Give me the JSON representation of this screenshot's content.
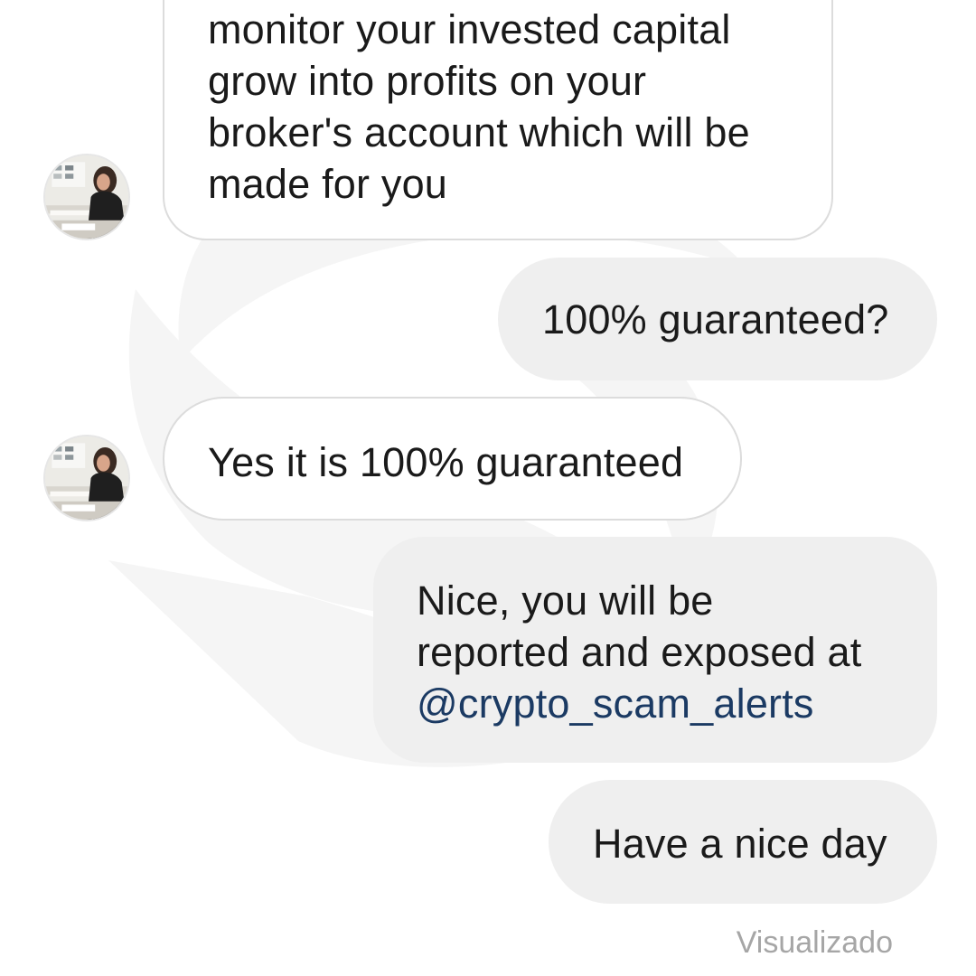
{
  "conversation": {
    "messages": [
      {
        "sender": "other",
        "lines": [
          "monitor your invested capital",
          "grow into profits on your",
          "broker's account which will be",
          "made for you"
        ]
      },
      {
        "sender": "me",
        "lines": [
          "100% guaranteed?"
        ]
      },
      {
        "sender": "other",
        "lines": [
          "Yes it is 100% guaranteed"
        ]
      },
      {
        "sender": "me",
        "lines": [
          "Nice, you will be",
          "reported and exposed at",
          "@crypto_scam_alerts"
        ]
      },
      {
        "sender": "me",
        "lines": [
          "Have a nice day"
        ]
      }
    ],
    "seen_status": "Visualizado"
  },
  "colors": {
    "incoming_bubble_border": "#dcdcdc",
    "outgoing_bubble_bg": "#efefef",
    "mention_link": "#1b3a63",
    "seen_text": "#a6a6a6"
  },
  "icons": {
    "contact_avatar": "woman-at-desk-photo"
  }
}
